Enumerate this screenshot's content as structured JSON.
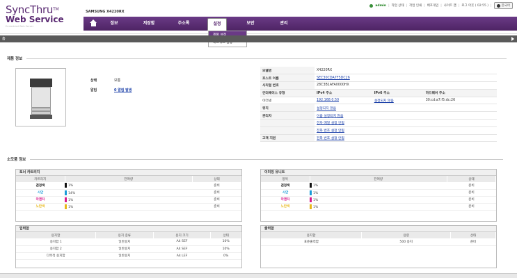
{
  "header": {
    "logo_line1": "SyncThru",
    "logo_tm": "TM",
    "logo_line2": "Web Service",
    "logo_sub": "Embedded Web Server",
    "model": "SAMSUNG X4220RX",
    "user": "admin",
    "links": [
      "작업 상태",
      "작업 인쇄",
      "배포게임",
      "사이트 맵",
      "로그 아웃 ( 02:55 )"
    ],
    "language": "한국어"
  },
  "nav": {
    "items": [
      "정보",
      "저장함",
      "주소록",
      "설정",
      "보안",
      "관리"
    ],
    "active": "설정",
    "dropdown": [
      "제품 설정",
      "네트워크 설정"
    ]
  },
  "page": {
    "home": "홈",
    "product_section": "제품 정보",
    "supplies_section": "소모품 정보"
  },
  "product": {
    "status_label": "상태",
    "status_value": "보통",
    "alert_label": "알림",
    "alert_value": "0 알림 발생"
  },
  "info": {
    "model_name_label": "모델명",
    "model_name": "X4220RX",
    "host_label": "호스트 이름",
    "host": "SEC30CDA7F5DC26",
    "serial_label": "시리얼 번호",
    "serial": "28C3B1AFA0000HX",
    "interface_label": "인터페이스 유형",
    "ipv4_label": "IPv4 주소",
    "ipv6_label": "IPv6 주소",
    "hw_label": "하드웨어 주소",
    "iface": "이더넷",
    "ipv4": "192.168.0.50",
    "ipv6": "설정되지 않음",
    "hw": "30:cd:a7:f5:dc:26",
    "location_label": "위치",
    "location": "설정되지 않음",
    "admin_label": "관리자",
    "admin_name": "이름 설정되지 않음",
    "admin_email": "전자 메일 설정 안됨",
    "admin_phone": "전화 번호 설정 안됨",
    "support_label": "고객 지원",
    "support": "전화 번호 설정 안됨"
  },
  "toner": {
    "title": "토너 카트리지",
    "headers": [
      "카트리지",
      "잔여량",
      "상태"
    ],
    "rows": [
      {
        "name": "검정색",
        "level": "1%",
        "status": "준비",
        "color": "#111111"
      },
      {
        "name": "시안",
        "level": "14%",
        "status": "준비",
        "color": "#1a9cd8"
      },
      {
        "name": "마젠타",
        "level": "1%",
        "status": "준비",
        "color": "#d81a8c"
      },
      {
        "name": "노란색",
        "level": "1%",
        "status": "준비",
        "color": "#e8b81a"
      }
    ],
    "fill": [
      0.01,
      0.14,
      0.01,
      0.01
    ]
  },
  "imaging": {
    "title": "이미징 유니트",
    "headers": [
      "항목",
      "잔여량",
      "상태"
    ],
    "rows": [
      {
        "name": "검정색",
        "level": "1%",
        "status": "준비",
        "color": "#111111"
      },
      {
        "name": "시안",
        "level": "1%",
        "status": "준비",
        "color": "#1a9cd8"
      },
      {
        "name": "마젠타",
        "level": "1%",
        "status": "준비",
        "color": "#d81a8c"
      },
      {
        "name": "노란색",
        "level": "1%",
        "status": "준비",
        "color": "#e8b81a"
      }
    ]
  },
  "input_tray": {
    "title": "입력함",
    "headers": [
      "용지함",
      "용지 종류",
      "용지 크기",
      "상태"
    ],
    "rows": [
      [
        "용지함 1",
        "일반용지",
        "A4 SEF",
        "10%"
      ],
      [
        "용지함 2",
        "일반용지",
        "A4 SEF",
        "10%"
      ],
      [
        "다목적 용지함",
        "일반용지",
        "A4 LEF",
        "0%"
      ]
    ]
  },
  "output_tray": {
    "title": "출력함",
    "headers": [
      "용지함",
      "용량",
      "상태"
    ],
    "rows": [
      [
        "표준출력함",
        "500 용지",
        "준비"
      ]
    ]
  }
}
